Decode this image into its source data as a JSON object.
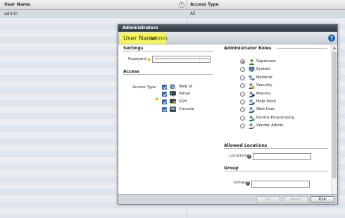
{
  "background_table": {
    "columns": [
      "User Name",
      "Access Type"
    ],
    "rows": [
      [
        "admin",
        "All"
      ]
    ]
  },
  "modal": {
    "title": "Administrators",
    "user_name_label": "User Name",
    "user_name_value": "admin",
    "help_icon": "?"
  },
  "settings": {
    "title": "Settings",
    "password_label": "Password",
    "password_value": "••••••••••••••••••••••••••••••••••••••••••••"
  },
  "access": {
    "title": "Access",
    "access_type_label": "Access Type",
    "types": [
      {
        "label": "Web UI",
        "checked": true,
        "icon": "web-ui-icon"
      },
      {
        "label": "Telnet",
        "checked": true,
        "icon": "telnet-icon"
      },
      {
        "label": "SSH",
        "checked": true,
        "icon": "ssh-icon"
      },
      {
        "label": "Console",
        "checked": true,
        "icon": "console-icon"
      }
    ]
  },
  "roles": {
    "title": "Administrator Roles",
    "items": [
      {
        "label": "Superuser",
        "selected": true
      },
      {
        "label": "System",
        "selected": false
      },
      {
        "label": "Network",
        "selected": false
      },
      {
        "label": "Security",
        "selected": false
      },
      {
        "label": "Monitor",
        "selected": false
      },
      {
        "label": "Help Desk",
        "selected": false
      },
      {
        "label": "Web User",
        "selected": false
      },
      {
        "label": "Device Provisioning",
        "selected": false
      },
      {
        "label": "Vendor Admin",
        "selected": false
      }
    ]
  },
  "allowed_locations": {
    "title": "Allowed Locations",
    "locations_label": "Locations",
    "locations_value": ""
  },
  "group": {
    "title": "Group",
    "group_label": "Group",
    "group_value": ""
  },
  "footer": {
    "ok_label": "OK",
    "reset_label": "Reset",
    "exit_label": "Exit"
  },
  "colors": {
    "highlight": "#f4f75c",
    "titlebar": "#2d3640",
    "checkbox": "#2f6db3",
    "required_star": "#e8a400"
  }
}
